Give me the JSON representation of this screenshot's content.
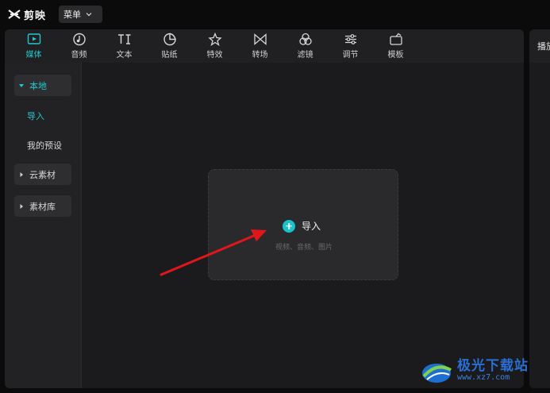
{
  "app": {
    "title": "剪映",
    "menu_label": "菜单"
  },
  "toolbar": {
    "tabs": [
      {
        "label": "媒体",
        "icon": "media-icon",
        "active": true
      },
      {
        "label": "音频",
        "icon": "audio-icon"
      },
      {
        "label": "文本",
        "icon": "text-icon"
      },
      {
        "label": "贴纸",
        "icon": "sticker-icon"
      },
      {
        "label": "特效",
        "icon": "effects-icon"
      },
      {
        "label": "转场",
        "icon": "transition-icon"
      },
      {
        "label": "滤镜",
        "icon": "filter-icon"
      },
      {
        "label": "调节",
        "icon": "adjust-icon"
      },
      {
        "label": "模板",
        "icon": "template-icon"
      }
    ]
  },
  "sidebar": {
    "items": [
      {
        "label": "本地",
        "expanded": true
      },
      {
        "label": "导入",
        "selected": true
      },
      {
        "label": "我的预设"
      },
      {
        "label": "云素材",
        "expanded": false
      },
      {
        "label": "素材库",
        "expanded": false
      }
    ]
  },
  "dropzone": {
    "label": "导入",
    "hint": "视频、音频、图片"
  },
  "right_panel": {
    "title": "播放器"
  },
  "watermark": {
    "name": "极光下载站",
    "url": "www.xz7.com"
  },
  "colors": {
    "accent": "#1fc8cf",
    "annotation_arrow": "#e0161b",
    "background": "#1b1b1d"
  }
}
